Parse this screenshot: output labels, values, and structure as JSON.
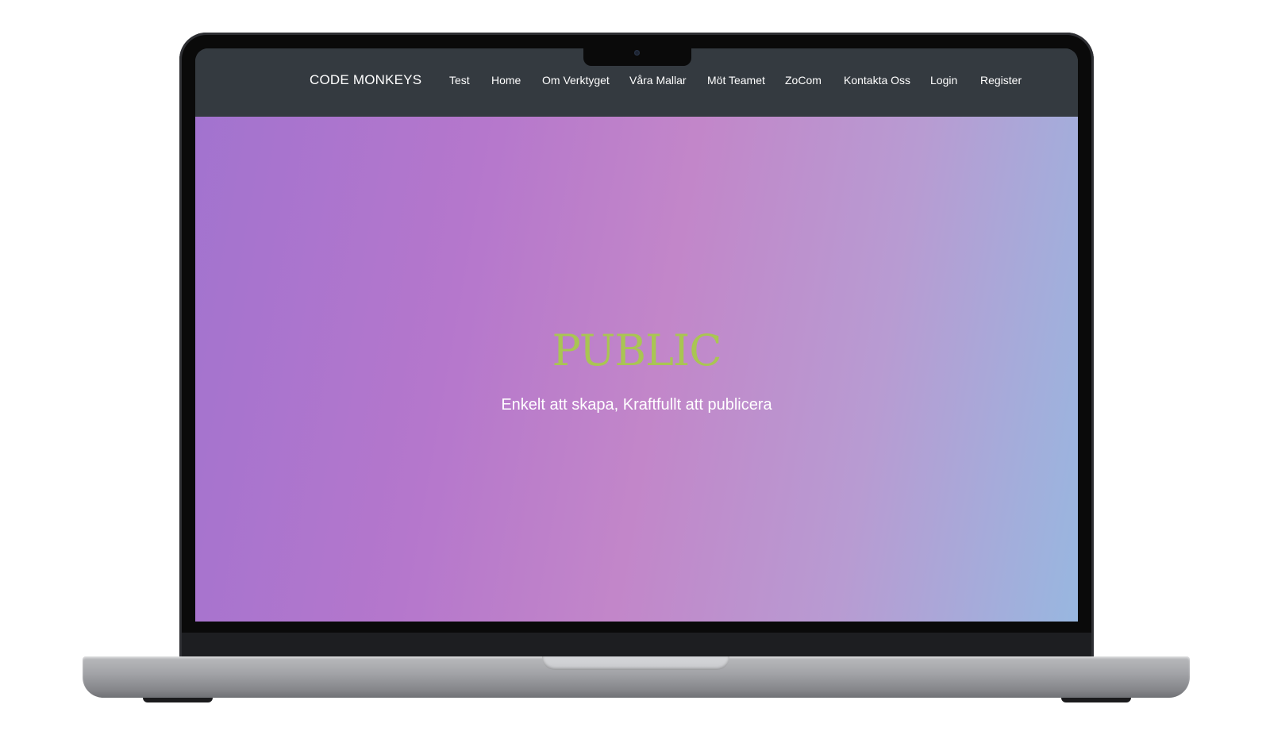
{
  "navbar": {
    "brand": "CODE MONKEYS",
    "items": [
      {
        "label": "Test"
      },
      {
        "label": "Home"
      },
      {
        "label": "Om Verktyget"
      },
      {
        "label": "Våra Mallar"
      },
      {
        "label": "Möt Teamet"
      },
      {
        "label": "ZoCom"
      },
      {
        "label": "Kontakta Oss"
      },
      {
        "label": "Login"
      },
      {
        "label": "Register"
      }
    ]
  },
  "hero": {
    "title": "PUBLIC",
    "subtitle": "Enkelt att skapa, Kraftfullt att publicera"
  },
  "colors": {
    "navbar_bg": "#343a40",
    "title_green": "#a9c553",
    "gradient_start": "#a273cf",
    "gradient_end": "#98b7e0"
  }
}
